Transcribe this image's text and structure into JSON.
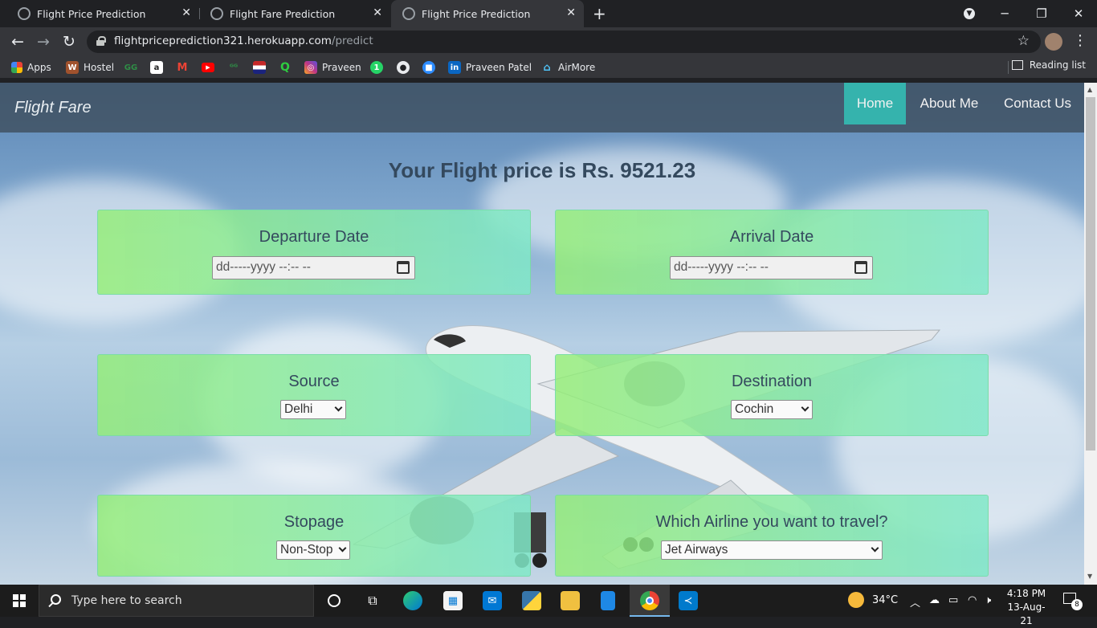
{
  "browser": {
    "tabs": [
      {
        "title": "Flight Price Prediction",
        "active": false
      },
      {
        "title": "Flight Fare Prediction",
        "active": false
      },
      {
        "title": "Flight Price Prediction",
        "active": true
      }
    ],
    "url_host": "flightpriceprediction321.herokuapp.com",
    "url_path": "/predict",
    "bookmarks": [
      {
        "label": "Apps",
        "icon": "apps-grid-icon",
        "color": "#4285f4"
      },
      {
        "label": "Hostel",
        "icon": "hostel-icon",
        "color": "#a0522d"
      },
      {
        "label": "",
        "icon": "gfg-icon",
        "color": "#2f8d46"
      },
      {
        "label": "",
        "icon": "amazon-icon",
        "color": "#222222"
      },
      {
        "label": "",
        "icon": "gmail-icon",
        "color": "#ea4335"
      },
      {
        "label": "",
        "icon": "youtube-icon",
        "color": "#ff0000"
      },
      {
        "label": "",
        "icon": "gfg-icon",
        "color": "#2f8d46"
      },
      {
        "label": "",
        "icon": "bookmark-flag-icon",
        "color": "#c62828"
      },
      {
        "label": "",
        "icon": "quora-q-icon",
        "color": "#2ecc40"
      },
      {
        "label": "Praveen",
        "icon": "instagram-icon",
        "color": "#c13584"
      },
      {
        "label": "",
        "icon": "whatsapp-icon",
        "color": "#25d366"
      },
      {
        "label": "",
        "icon": "github-icon",
        "color": "#e8eaed"
      },
      {
        "label": "",
        "icon": "zoom-icon",
        "color": "#2d8cff"
      },
      {
        "label": "Praveen Patel",
        "icon": "linkedin-icon",
        "color": "#0a66c2"
      },
      {
        "label": "AirMore",
        "icon": "airmore-icon",
        "color": "#4fc3f7"
      }
    ],
    "reading_list": "Reading list"
  },
  "page": {
    "brand": "Flight Fare",
    "nav": [
      {
        "label": "Home",
        "active": true
      },
      {
        "label": "About Me",
        "active": false
      },
      {
        "label": "Contact Us",
        "active": false
      }
    ],
    "result": "Your Flight price is Rs. 9521.23",
    "departure": {
      "label": "Departure Date",
      "placeholder": "dd-----yyyy --:-- --"
    },
    "arrival": {
      "label": "Arrival Date",
      "placeholder": "dd-----yyyy --:-- --"
    },
    "source": {
      "label": "Source",
      "value": "Delhi"
    },
    "destination": {
      "label": "Destination",
      "value": "Cochin"
    },
    "stopage": {
      "label": "Stopage",
      "value": "Non-Stop"
    },
    "airline": {
      "label": "Which Airline you want to travel?",
      "value": "Jet Airways"
    },
    "colors": {
      "accent": "#35b3ad",
      "heading": "#34495e"
    }
  },
  "taskbar": {
    "search_placeholder": "Type here to search",
    "temperature": "34°C",
    "time": "4:18 PM",
    "date": "13-Aug-21",
    "notifications": "8"
  }
}
